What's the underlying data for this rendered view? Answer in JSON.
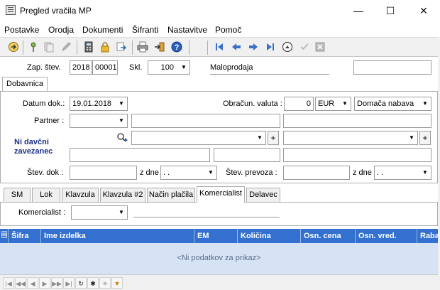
{
  "window": {
    "title": "Pregled vračila MP",
    "minimize": "—",
    "maximize": "☐",
    "close": "✕"
  },
  "menu": [
    "Postavke",
    "Orodja",
    "Dokumenti",
    "Šifranti",
    "Nastavitve",
    "Pomoč"
  ],
  "toolbar": {
    "icons": [
      "exit-icon",
      "pin-icon",
      "copy-icon",
      "edit-icon",
      "calculator-icon",
      "lock-icon",
      "export-icon",
      "print-icon",
      "import-icon",
      "help-icon",
      "first-icon",
      "prev-icon",
      "next-icon",
      "last-icon",
      "up-icon",
      "confirm-icon",
      "cancel-icon"
    ]
  },
  "header": {
    "zap_label": "Zap. štev.",
    "year": "2018",
    "number": "00001",
    "skl_label": "Skl.",
    "warehouse": "100",
    "warehouse_name": "Maloprodaja"
  },
  "tabs_main": [
    {
      "label": "Dobavnica",
      "active": true
    }
  ],
  "form": {
    "datum_label": "Datum dok.:",
    "datum_value": "19.01.2018",
    "valuta_label": "Obračun. valuta :",
    "valuta_amount": "0",
    "valuta_currency": "EUR",
    "nabava_type": "Domača nabava",
    "partner_label": "Partner :",
    "ni_davcni_line1": "Ni davčni",
    "ni_davcni_line2": "zavezanec",
    "stev_dok_label": "Štev. dok :",
    "z_dne_label": "z dne",
    "date_placeholder": " .  .",
    "stev_prevoza_label": "Štev. prevoza :",
    "z_dne2_label": "z dne",
    "date2_placeholder": " .  ."
  },
  "tabs_sub": [
    {
      "label": "SM"
    },
    {
      "label": "Lok"
    },
    {
      "label": "Klavzula"
    },
    {
      "label": "Klavzula #2"
    },
    {
      "label": "Način plačila"
    },
    {
      "label": "Komercialist",
      "active": true
    },
    {
      "label": "Delavec"
    }
  ],
  "sub": {
    "komercialist_label": "Komercialist :"
  },
  "grid": {
    "columns": [
      "Šifra",
      "Ime izdelka",
      "EM",
      "Količina",
      "Osn. cena",
      "Osn. vred.",
      "Raba"
    ],
    "empty_message": "<Ni podatkov za prikaz>"
  },
  "colors": {
    "grid_header": "#3370d0",
    "grid_body": "#d6e3f5",
    "ni_davcni": "#1a2f8a"
  }
}
